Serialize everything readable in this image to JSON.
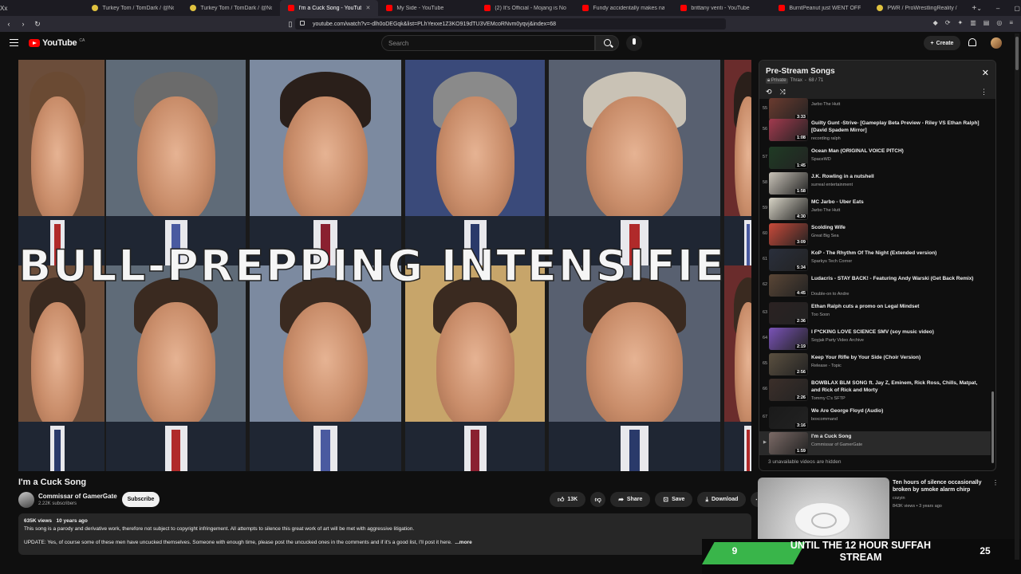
{
  "browser": {
    "tabs": [
      {
        "title": "Turkey Tom / TomDark / @NotATom",
        "icon": "tw"
      },
      {
        "title": "Turkey Tom / TomDark / @NotATom",
        "icon": "tw"
      },
      {
        "title": "I'm a Cuck Song - YouTube",
        "icon": "yt",
        "active": true
      },
      {
        "title": "My Side - YouTube",
        "icon": "yt"
      },
      {
        "title": "(2) It's Official - Mojang is Now BA",
        "icon": "yt"
      },
      {
        "title": "Fundy accidentally makes nazi sym",
        "icon": "yt"
      },
      {
        "title": "brittany venti - YouTube",
        "icon": "yt"
      },
      {
        "title": "BurntPeanut just WENT OFF on V1",
        "icon": "yt"
      },
      {
        "title": "PWR / ProWrestlingReality / realp",
        "icon": "tw"
      }
    ],
    "url": "youtube.com/watch?v=-dlh0oDEGqk&list=PLhYexxe1Z3KO919dTU3VEMcoRNvm0yqvj&index=68"
  },
  "header": {
    "logo_text": "YouTube",
    "logo_country": "CA",
    "search_placeholder": "Search",
    "create_label": "Create"
  },
  "player": {
    "overlay_text": "BULL-PREPPING INTENSIFIE"
  },
  "video": {
    "title": "I'm a Cuck Song",
    "channel": "Commissar of GamerGate",
    "subscribers": "2.22K subscribers",
    "subscribe_label": "Subscribe",
    "likes": "13K",
    "share_label": "Share",
    "save_label": "Save",
    "download_label": "Download",
    "views": "635K views",
    "age": "10 years ago",
    "desc_line1": "This song is a parody and derivative work, therefore not subject to copyright infringement. All attempts to silence this great work of art will be met with aggressive litigation.",
    "desc_line2": "UPDATE: Yes, of course some of these men have uncucked themselves. Someone with enough time, please post the uncucked ones in the comments and if it's a good list, I'll post it here.",
    "more_label": "...more"
  },
  "playlist": {
    "title": "Pre-Stream Songs",
    "privacy": "Private",
    "owner": "Thrax",
    "position": "68 / 71",
    "hidden_note": "3 unavailable videos are hidden",
    "items": [
      {
        "num": "55",
        "title": "",
        "channel": "Jarbo The Hutt",
        "duration": "3:33",
        "thumb": "#6b3b2f"
      },
      {
        "num": "56",
        "title": "Guilty Gunt -Strive- [Gameplay Beta Preview - Riley VS Ethan Ralph] [David Spadem Mirror]",
        "channel": "recording ralph",
        "duration": "1:08",
        "thumb": "#a23a4e"
      },
      {
        "num": "57",
        "title": "Ocean Man (ORIGINAL VOICE PITCH)",
        "channel": "SpaceWD",
        "duration": "1:45",
        "thumb": "#1f3b24"
      },
      {
        "num": "58",
        "title": "J.K. Rowling in a nutshell",
        "channel": "surreal entertainment",
        "duration": "1:58",
        "thumb": "#c9c3b8"
      },
      {
        "num": "59",
        "title": "MC Jarbo - Uber Eats",
        "channel": "Jarbo The Hutt",
        "duration": "4:30",
        "thumb": "#d8d4c6"
      },
      {
        "num": "60",
        "title": "Scolding Wife",
        "channel": "Great Big Sea",
        "duration": "3:09",
        "thumb": "#c94a3a"
      },
      {
        "num": "61",
        "title": "KoP - The Rhythm Of The Night (Extended version)",
        "channel": "Sparkys Tech Corner",
        "duration": "5:34",
        "thumb": "#2a2f3c"
      },
      {
        "num": "62",
        "title": "Ludacris - STAY BACK! - Featuring Andy Warski (Get Back Remix)",
        "channel": "Double-on to Andre",
        "duration": "4:45",
        "thumb": "#5a4636"
      },
      {
        "num": "63",
        "title": "Ethan Ralph cuts a promo on Legal Mindset",
        "channel": "Too Soon",
        "duration": "2:36",
        "thumb": "#2b2222"
      },
      {
        "num": "64",
        "title": "I F*CKING LOVE SCIENCE SMV (soy music video)",
        "channel": "Soyjak Party Video Archive",
        "duration": "2:19",
        "thumb": "#7a53b8"
      },
      {
        "num": "65",
        "title": "Keep Your Rifle by Your Side (Choir Version)",
        "channel": "Release - Topic",
        "duration": "2:56",
        "thumb": "#5b5040"
      },
      {
        "num": "66",
        "title": "BOWBLAX BLM SONG ft. Jay Z, Eminem, Rick Ross, Chills, Matpat, and Rick of Rick and Morty",
        "channel": "Tommy C's SFTP",
        "duration": "2:26",
        "thumb": "#3c2f2a"
      },
      {
        "num": "67",
        "title": "We Are George Floyd (Audio)",
        "channel": "boxcommand",
        "duration": "3:16",
        "thumb": "#1a1a1a"
      },
      {
        "num": "",
        "title": "I'm a Cuck Song",
        "channel": "Commissar of GamerGate",
        "duration": "1:59",
        "thumb": "#7b6a66",
        "current": true
      }
    ]
  },
  "recommended": {
    "title": "Ten hours of silence occasionally broken by smoke alarm chirp",
    "channel": "cozyin",
    "views": "843K views",
    "age": "3 years ago"
  },
  "stream_overlay": {
    "left_number": "9",
    "text": "UNTIL THE 12 HOUR SUFFAH STREAM",
    "right_number": "25"
  }
}
